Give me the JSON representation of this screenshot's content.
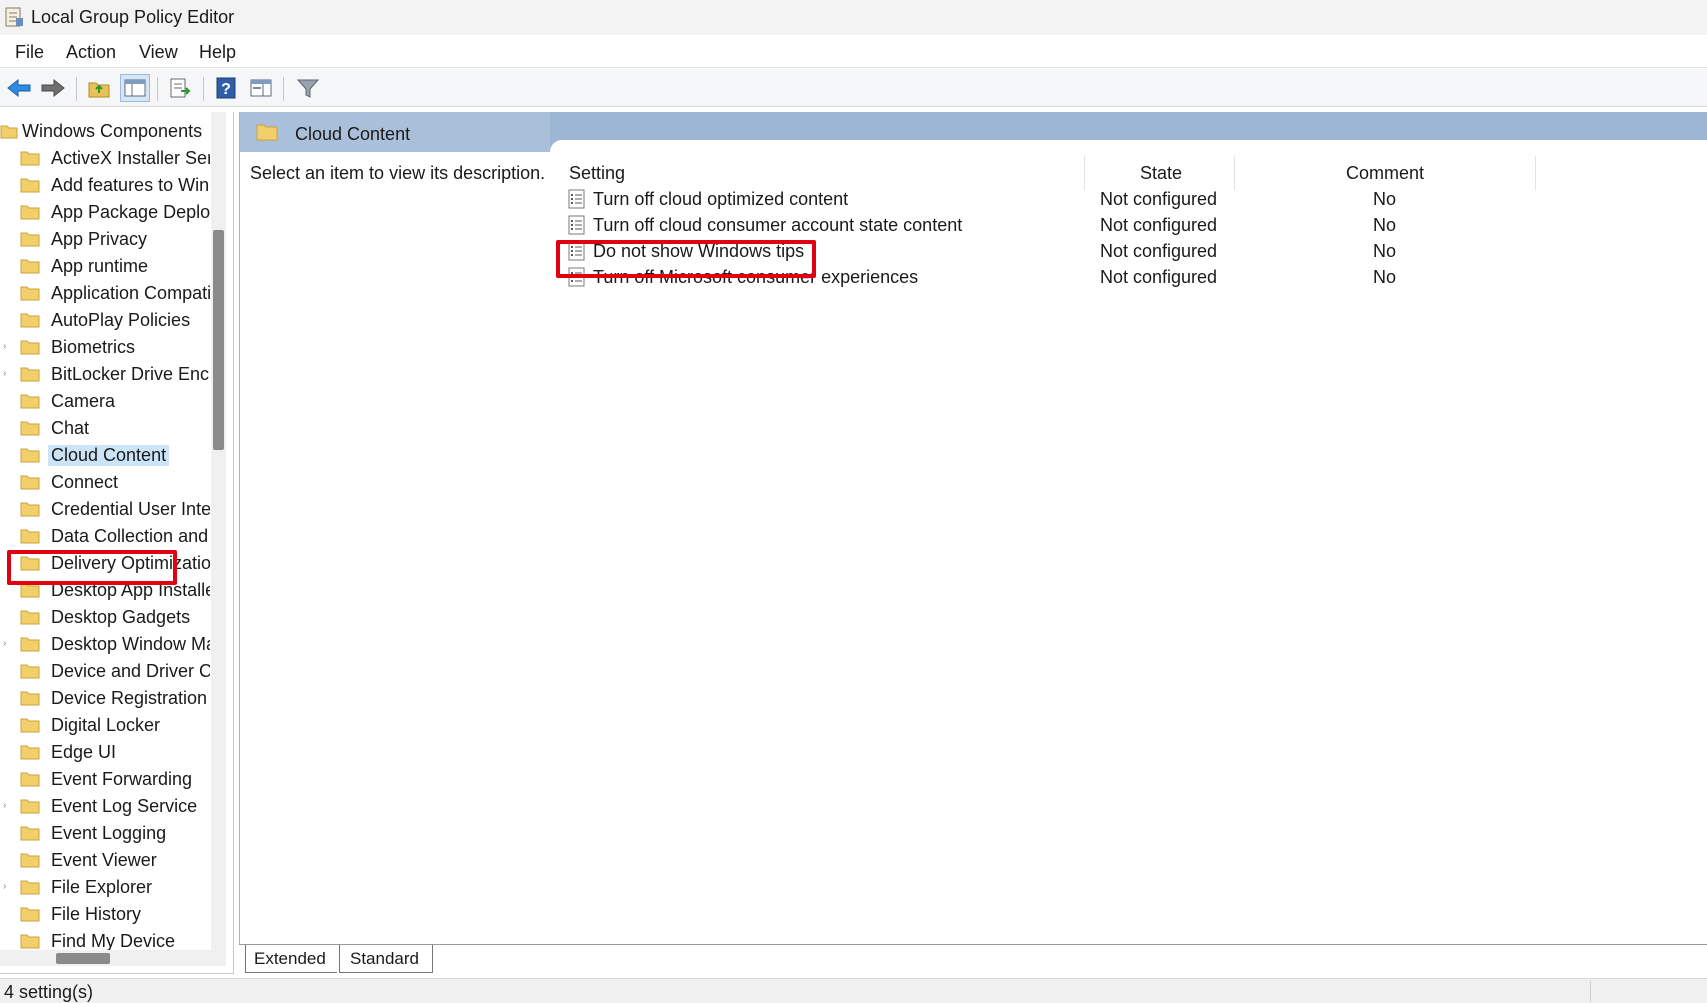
{
  "window": {
    "title": "Local Group Policy Editor"
  },
  "menu": [
    "File",
    "Action",
    "View",
    "Help"
  ],
  "toolbar": {
    "buttons": [
      "back-icon",
      "forward-icon",
      "up-folder-icon",
      "show-hide-tree-icon",
      "export-list-icon",
      "help-icon",
      "properties-icon",
      "filter-icon"
    ]
  },
  "tree": {
    "root_label": "Windows Components",
    "items": [
      {
        "label": "ActiveX Installer Service",
        "expandable": false
      },
      {
        "label": "Add features to Windows",
        "expandable": false
      },
      {
        "label": "App Package Deployment",
        "expandable": false
      },
      {
        "label": "App Privacy",
        "expandable": false
      },
      {
        "label": "App runtime",
        "expandable": false
      },
      {
        "label": "Application Compatibility",
        "expandable": false
      },
      {
        "label": "AutoPlay Policies",
        "expandable": false
      },
      {
        "label": "Biometrics",
        "expandable": true
      },
      {
        "label": "BitLocker Drive Encryption",
        "expandable": true
      },
      {
        "label": "Camera",
        "expandable": false
      },
      {
        "label": "Chat",
        "expandable": false
      },
      {
        "label": "Cloud Content",
        "expandable": false,
        "selected": true
      },
      {
        "label": "Connect",
        "expandable": false
      },
      {
        "label": "Credential User Interface",
        "expandable": false
      },
      {
        "label": "Data Collection and Preview Builds",
        "expandable": false
      },
      {
        "label": "Delivery Optimization",
        "expandable": false
      },
      {
        "label": "Desktop App Installer",
        "expandable": false
      },
      {
        "label": "Desktop Gadgets",
        "expandable": false
      },
      {
        "label": "Desktop Window Manager",
        "expandable": true
      },
      {
        "label": "Device and Driver Compatibility",
        "expandable": false
      },
      {
        "label": "Device Registration",
        "expandable": false
      },
      {
        "label": "Digital Locker",
        "expandable": false
      },
      {
        "label": "Edge UI",
        "expandable": false
      },
      {
        "label": "Event Forwarding",
        "expandable": false
      },
      {
        "label": "Event Log Service",
        "expandable": true
      },
      {
        "label": "Event Logging",
        "expandable": false
      },
      {
        "label": "Event Viewer",
        "expandable": false
      },
      {
        "label": "File Explorer",
        "expandable": true
      },
      {
        "label": "File History",
        "expandable": false
      },
      {
        "label": "Find My Device",
        "expandable": false
      }
    ]
  },
  "content": {
    "header_title": "Cloud Content",
    "description": "Select an item to view its description.",
    "columns": {
      "setting": "Setting",
      "state": "State",
      "comment": "Comment"
    },
    "rows": [
      {
        "name": "Turn off cloud optimized content",
        "state": "Not configured",
        "comment": "No"
      },
      {
        "name": "Turn off cloud consumer account state content",
        "state": "Not configured",
        "comment": "No"
      },
      {
        "name": "Do not show Windows tips",
        "state": "Not configured",
        "comment": "No",
        "highlighted": true
      },
      {
        "name": "Turn off Microsoft consumer experiences",
        "state": "Not configured",
        "comment": "No"
      }
    ]
  },
  "tabs": [
    "Extended",
    "Standard"
  ],
  "status": {
    "text": "4 setting(s)"
  },
  "colors": {
    "highlight_red": "#e0000f",
    "header_blue": "#9db6d3",
    "selection_blue": "#cce4f7"
  }
}
